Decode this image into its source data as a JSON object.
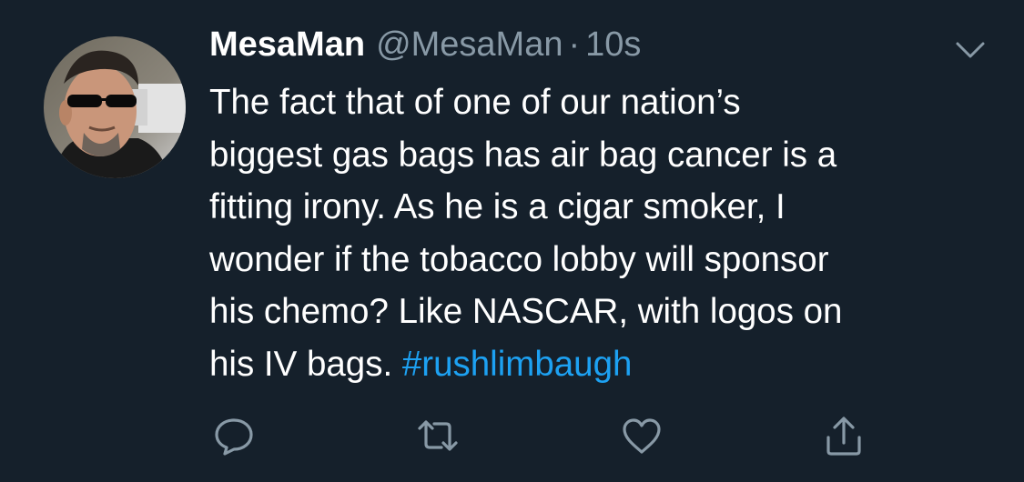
{
  "tweet": {
    "author": {
      "display_name": "MesaMan",
      "handle": "@MesaMan"
    },
    "separator": "·",
    "timestamp": "10s",
    "text_lines": [
      "The fact that of one of our nation’s",
      "biggest gas bags has air bag cancer is a",
      "fitting irony. As he is a cigar smoker, I",
      "wonder if the tobacco lobby will sponsor",
      "his chemo? Like NASCAR, with logos on",
      "his IV bags. "
    ],
    "hashtag": "#rushlimbaugh"
  },
  "icons": {
    "menu": "chevron-down-icon",
    "actions": [
      "reply-icon",
      "retweet-icon",
      "like-icon",
      "share-icon"
    ]
  },
  "colors": {
    "background": "#15202b",
    "text": "#ffffff",
    "secondary": "#8899a6",
    "link": "#1da1f2"
  }
}
